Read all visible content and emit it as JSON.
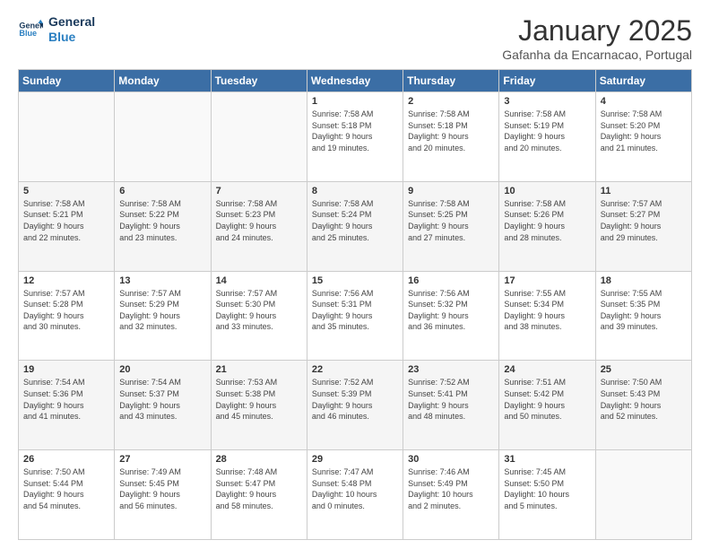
{
  "header": {
    "logo_line1": "General",
    "logo_line2": "Blue",
    "month": "January 2025",
    "location": "Gafanha da Encarnacao, Portugal"
  },
  "weekdays": [
    "Sunday",
    "Monday",
    "Tuesday",
    "Wednesday",
    "Thursday",
    "Friday",
    "Saturday"
  ],
  "weeks": [
    [
      {
        "day": "",
        "info": ""
      },
      {
        "day": "",
        "info": ""
      },
      {
        "day": "",
        "info": ""
      },
      {
        "day": "1",
        "info": "Sunrise: 7:58 AM\nSunset: 5:18 PM\nDaylight: 9 hours\nand 19 minutes."
      },
      {
        "day": "2",
        "info": "Sunrise: 7:58 AM\nSunset: 5:18 PM\nDaylight: 9 hours\nand 20 minutes."
      },
      {
        "day": "3",
        "info": "Sunrise: 7:58 AM\nSunset: 5:19 PM\nDaylight: 9 hours\nand 20 minutes."
      },
      {
        "day": "4",
        "info": "Sunrise: 7:58 AM\nSunset: 5:20 PM\nDaylight: 9 hours\nand 21 minutes."
      }
    ],
    [
      {
        "day": "5",
        "info": "Sunrise: 7:58 AM\nSunset: 5:21 PM\nDaylight: 9 hours\nand 22 minutes."
      },
      {
        "day": "6",
        "info": "Sunrise: 7:58 AM\nSunset: 5:22 PM\nDaylight: 9 hours\nand 23 minutes."
      },
      {
        "day": "7",
        "info": "Sunrise: 7:58 AM\nSunset: 5:23 PM\nDaylight: 9 hours\nand 24 minutes."
      },
      {
        "day": "8",
        "info": "Sunrise: 7:58 AM\nSunset: 5:24 PM\nDaylight: 9 hours\nand 25 minutes."
      },
      {
        "day": "9",
        "info": "Sunrise: 7:58 AM\nSunset: 5:25 PM\nDaylight: 9 hours\nand 27 minutes."
      },
      {
        "day": "10",
        "info": "Sunrise: 7:58 AM\nSunset: 5:26 PM\nDaylight: 9 hours\nand 28 minutes."
      },
      {
        "day": "11",
        "info": "Sunrise: 7:57 AM\nSunset: 5:27 PM\nDaylight: 9 hours\nand 29 minutes."
      }
    ],
    [
      {
        "day": "12",
        "info": "Sunrise: 7:57 AM\nSunset: 5:28 PM\nDaylight: 9 hours\nand 30 minutes."
      },
      {
        "day": "13",
        "info": "Sunrise: 7:57 AM\nSunset: 5:29 PM\nDaylight: 9 hours\nand 32 minutes."
      },
      {
        "day": "14",
        "info": "Sunrise: 7:57 AM\nSunset: 5:30 PM\nDaylight: 9 hours\nand 33 minutes."
      },
      {
        "day": "15",
        "info": "Sunrise: 7:56 AM\nSunset: 5:31 PM\nDaylight: 9 hours\nand 35 minutes."
      },
      {
        "day": "16",
        "info": "Sunrise: 7:56 AM\nSunset: 5:32 PM\nDaylight: 9 hours\nand 36 minutes."
      },
      {
        "day": "17",
        "info": "Sunrise: 7:55 AM\nSunset: 5:34 PM\nDaylight: 9 hours\nand 38 minutes."
      },
      {
        "day": "18",
        "info": "Sunrise: 7:55 AM\nSunset: 5:35 PM\nDaylight: 9 hours\nand 39 minutes."
      }
    ],
    [
      {
        "day": "19",
        "info": "Sunrise: 7:54 AM\nSunset: 5:36 PM\nDaylight: 9 hours\nand 41 minutes."
      },
      {
        "day": "20",
        "info": "Sunrise: 7:54 AM\nSunset: 5:37 PM\nDaylight: 9 hours\nand 43 minutes."
      },
      {
        "day": "21",
        "info": "Sunrise: 7:53 AM\nSunset: 5:38 PM\nDaylight: 9 hours\nand 45 minutes."
      },
      {
        "day": "22",
        "info": "Sunrise: 7:52 AM\nSunset: 5:39 PM\nDaylight: 9 hours\nand 46 minutes."
      },
      {
        "day": "23",
        "info": "Sunrise: 7:52 AM\nSunset: 5:41 PM\nDaylight: 9 hours\nand 48 minutes."
      },
      {
        "day": "24",
        "info": "Sunrise: 7:51 AM\nSunset: 5:42 PM\nDaylight: 9 hours\nand 50 minutes."
      },
      {
        "day": "25",
        "info": "Sunrise: 7:50 AM\nSunset: 5:43 PM\nDaylight: 9 hours\nand 52 minutes."
      }
    ],
    [
      {
        "day": "26",
        "info": "Sunrise: 7:50 AM\nSunset: 5:44 PM\nDaylight: 9 hours\nand 54 minutes."
      },
      {
        "day": "27",
        "info": "Sunrise: 7:49 AM\nSunset: 5:45 PM\nDaylight: 9 hours\nand 56 minutes."
      },
      {
        "day": "28",
        "info": "Sunrise: 7:48 AM\nSunset: 5:47 PM\nDaylight: 9 hours\nand 58 minutes."
      },
      {
        "day": "29",
        "info": "Sunrise: 7:47 AM\nSunset: 5:48 PM\nDaylight: 10 hours\nand 0 minutes."
      },
      {
        "day": "30",
        "info": "Sunrise: 7:46 AM\nSunset: 5:49 PM\nDaylight: 10 hours\nand 2 minutes."
      },
      {
        "day": "31",
        "info": "Sunrise: 7:45 AM\nSunset: 5:50 PM\nDaylight: 10 hours\nand 5 minutes."
      },
      {
        "day": "",
        "info": ""
      }
    ]
  ]
}
